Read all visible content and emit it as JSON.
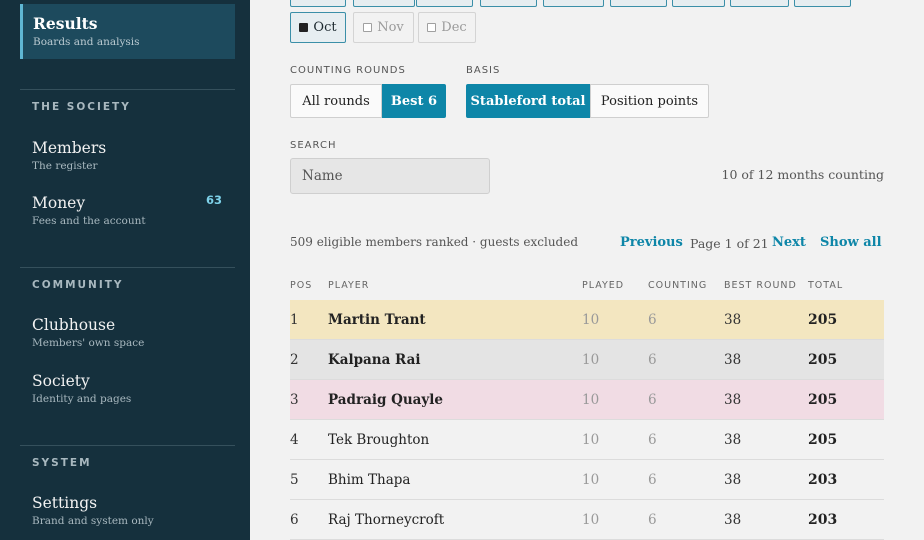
{
  "sidebar": {
    "active": {
      "title": "Results",
      "subtitle": "Boards and analysis"
    },
    "sections": [
      {
        "title": "THE SOCIETY",
        "items": [
          {
            "name": "Members",
            "sub": "The register",
            "badge": ""
          },
          {
            "name": "Money",
            "sub": "Fees and the account",
            "badge": "63"
          }
        ]
      },
      {
        "title": "COMMUNITY",
        "items": [
          {
            "name": "Clubhouse",
            "sub": "Members' own space"
          },
          {
            "name": "Society",
            "sub": "Identity and pages"
          }
        ]
      },
      {
        "title": "SYSTEM",
        "items": [
          {
            "name": "Settings",
            "sub": "Brand and system only"
          }
        ]
      }
    ]
  },
  "months": [
    {
      "label": "Oct",
      "checked": true
    },
    {
      "label": "Nov",
      "checked": false
    },
    {
      "label": "Dec",
      "checked": false
    }
  ],
  "counting": {
    "label": "COUNTING ROUNDS",
    "options": [
      "All rounds",
      "Best 6"
    ],
    "selected": "Best 6"
  },
  "basis": {
    "label": "BASIS",
    "options": [
      "Stableford total",
      "Position points"
    ],
    "selected": "Stableford total"
  },
  "search": {
    "label": "SEARCH",
    "placeholder": "Name"
  },
  "months_counting": "10 of 12 months counting",
  "eligible": "509 eligible members ranked · guests excluded",
  "pager": {
    "previous": "Previous",
    "info": "Page 1 of 21",
    "next": "Next",
    "show_all": "Show all"
  },
  "table": {
    "headers": [
      "POS",
      "PLAYER",
      "PLAYED",
      "COUNTING",
      "BEST ROUND",
      "TOTAL"
    ],
    "rows": [
      {
        "pos": "1",
        "player": "Martin Trant",
        "played": "10",
        "counting": "6",
        "best": "38",
        "total": "205",
        "bg": "#f3e6c0",
        "bold": true
      },
      {
        "pos": "2",
        "player": "Kalpana Rai",
        "played": "10",
        "counting": "6",
        "best": "38",
        "total": "205",
        "bg": "#e4e4e4",
        "bold": true
      },
      {
        "pos": "3",
        "player": "Padraig Quayle",
        "played": "10",
        "counting": "6",
        "best": "38",
        "total": "205",
        "bg": "#f1dce4",
        "bold": true
      },
      {
        "pos": "4",
        "player": "Tek Broughton",
        "played": "10",
        "counting": "6",
        "best": "38",
        "total": "205",
        "bg": "",
        "bold": false
      },
      {
        "pos": "5",
        "player": "Bhim Thapa",
        "played": "10",
        "counting": "6",
        "best": "38",
        "total": "203",
        "bg": "",
        "bold": false
      },
      {
        "pos": "6",
        "player": "Raj Thorneycroft",
        "played": "10",
        "counting": "6",
        "best": "38",
        "total": "203",
        "bg": "",
        "bold": false
      }
    ]
  },
  "colors": {
    "accent": "#0e86a8",
    "sidebar": "#15303d"
  }
}
